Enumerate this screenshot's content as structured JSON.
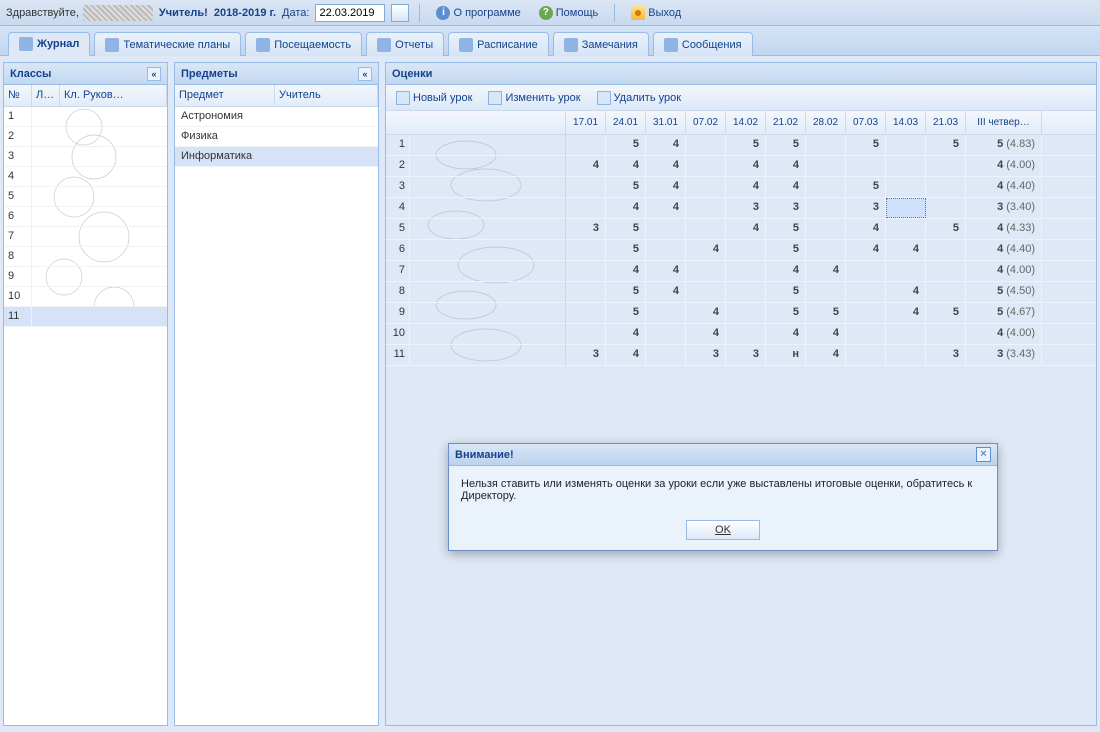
{
  "topbar": {
    "greeting": "Здравствуйте,",
    "role": "Учитель!",
    "year": "2018-2019 г.",
    "date_label": "Дата:",
    "date_value": "22.03.2019",
    "about": "О программе",
    "help": "Помощь",
    "exit": "Выход"
  },
  "tabs": [
    {
      "label": "Журнал",
      "active": true
    },
    {
      "label": "Тематические планы"
    },
    {
      "label": "Посещаемость"
    },
    {
      "label": "Отчеты"
    },
    {
      "label": "Расписание"
    },
    {
      "label": "Замечания"
    },
    {
      "label": "Сообщения"
    }
  ],
  "classes_panel": {
    "title": "Классы",
    "cols": {
      "num": "№",
      "letter": "Л…",
      "ruk": "Кл. Руков…"
    },
    "rows": [
      1,
      2,
      3,
      4,
      5,
      6,
      7,
      8,
      9,
      10,
      11
    ],
    "selected": 11
  },
  "subjects_panel": {
    "title": "Предметы",
    "cols": {
      "subject": "Предмет",
      "teacher": "Учитель"
    },
    "rows": [
      "Астрономия",
      "Физика",
      "Информатика"
    ],
    "selected": "Информатика"
  },
  "grades_panel": {
    "title": "Оценки",
    "toolbar": {
      "new": "Новый урок",
      "edit": "Изменить урок",
      "del": "Удалить урок"
    },
    "date_cols": [
      "17.01",
      "24.01",
      "31.01",
      "07.02",
      "14.02",
      "21.02",
      "28.02",
      "07.03",
      "14.03",
      "21.03"
    ],
    "quarter_col": "III четвер…",
    "rows": [
      {
        "n": 1,
        "g": [
          "",
          "5",
          "4",
          "",
          "5",
          "5",
          "",
          "5",
          "",
          "5"
        ],
        "q": "5",
        "avg": "(4.83)"
      },
      {
        "n": 2,
        "g": [
          "4",
          "4",
          "4",
          "",
          "4",
          "4",
          "",
          "",
          "",
          ""
        ],
        "q": "4",
        "avg": "(4.00)"
      },
      {
        "n": 3,
        "g": [
          "",
          "5",
          "4",
          "",
          "4",
          "4",
          "",
          "5",
          "",
          ""
        ],
        "q": "4",
        "avg": "(4.40)"
      },
      {
        "n": 4,
        "g": [
          "",
          "4",
          "4",
          "",
          "3",
          "3",
          "",
          "3",
          "",
          ""
        ],
        "q": "3",
        "avg": "(3.40)"
      },
      {
        "n": 5,
        "g": [
          "3",
          "5",
          "",
          "",
          "4",
          "5",
          "",
          "4",
          "",
          "5"
        ],
        "q": "4",
        "avg": "(4.33)"
      },
      {
        "n": 6,
        "g": [
          "",
          "5",
          "",
          "4",
          "",
          "5",
          "",
          "4",
          "4",
          ""
        ],
        "q": "4",
        "avg": "(4.40)"
      },
      {
        "n": 7,
        "g": [
          "",
          "4",
          "4",
          "",
          "",
          "4",
          "4",
          "",
          "",
          ""
        ],
        "q": "4",
        "avg": "(4.00)"
      },
      {
        "n": 8,
        "g": [
          "",
          "5",
          "4",
          "",
          "",
          "5",
          "",
          "",
          "4",
          ""
        ],
        "q": "5",
        "avg": "(4.50)"
      },
      {
        "n": 9,
        "g": [
          "",
          "5",
          "",
          "4",
          "",
          "5",
          "5",
          "",
          "4",
          "5"
        ],
        "q": "5",
        "avg": "(4.67)"
      },
      {
        "n": 10,
        "g": [
          "",
          "4",
          "",
          "4",
          "",
          "4",
          "4",
          "",
          "",
          ""
        ],
        "q": "4",
        "avg": "(4.00)"
      },
      {
        "n": 11,
        "g": [
          "3",
          "4",
          "",
          "3",
          "3",
          "н",
          "4",
          "",
          "",
          "3"
        ],
        "q": "3",
        "avg": "(3.43)"
      }
    ],
    "selected_cell": {
      "row": 4,
      "col": 8
    }
  },
  "dialog": {
    "title": "Внимание!",
    "text": "Нельзя ставить или изменять оценки за уроки если уже выставлены итоговые оценки, обратитесь к Директору.",
    "ok": "OK"
  }
}
